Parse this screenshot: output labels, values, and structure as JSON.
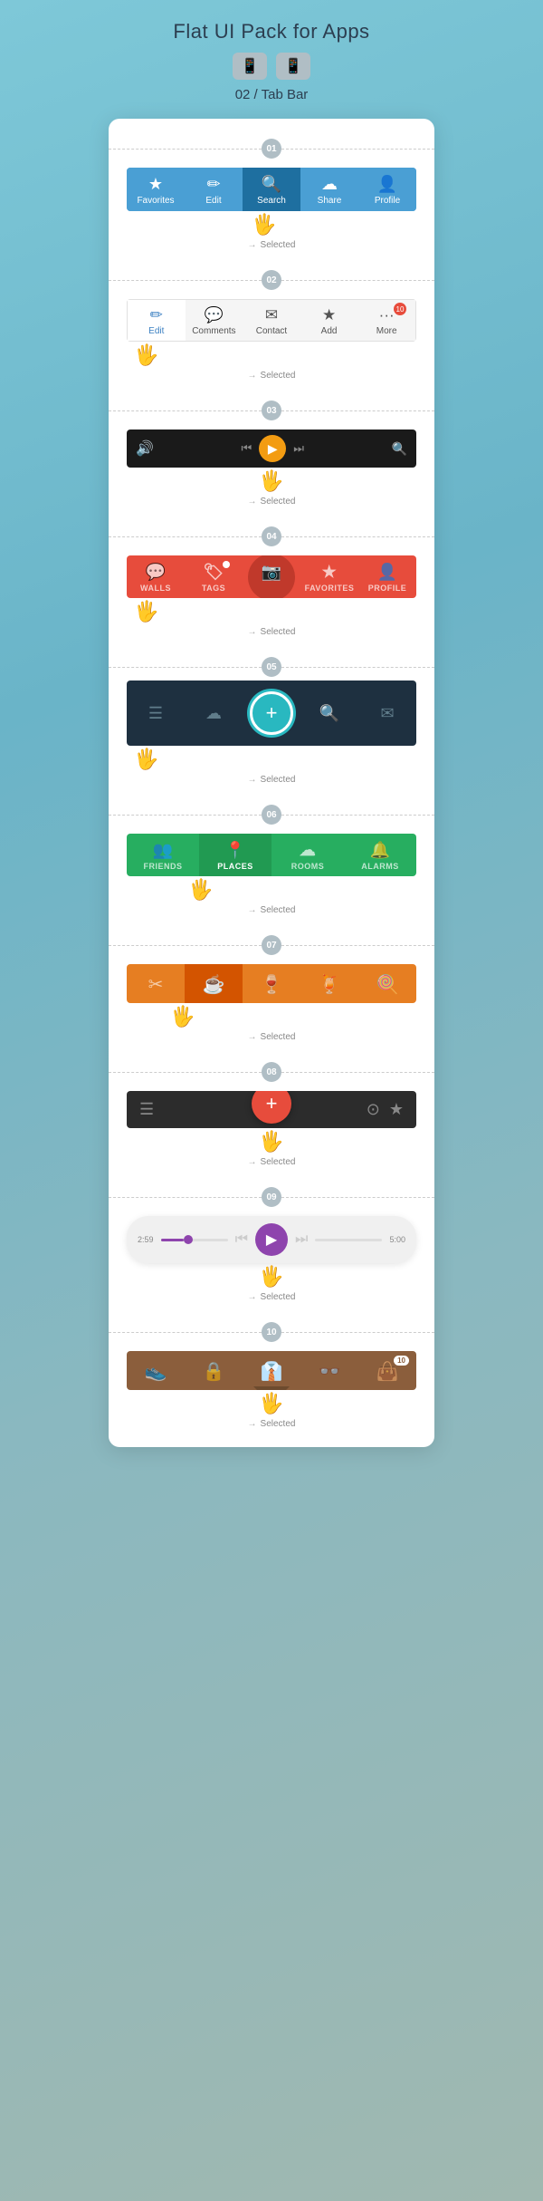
{
  "header": {
    "title": "Flat UI Pack for Apps",
    "subtitle": "02 / Tab Bar"
  },
  "sections": [
    {
      "id": "01",
      "tabs": [
        {
          "icon": "★",
          "label": "Favorites",
          "active": false
        },
        {
          "icon": "✎",
          "label": "Edit",
          "active": false
        },
        {
          "icon": "🔍",
          "label": "Search",
          "active": true
        },
        {
          "icon": "☁",
          "label": "Share",
          "active": false
        },
        {
          "icon": "👤",
          "label": "Profile",
          "active": false
        }
      ],
      "selected": "Selected",
      "selected_tab": "Search",
      "pointer_pos": "left_offset_2"
    },
    {
      "id": "02",
      "tabs": [
        {
          "icon": "✎",
          "label": "Edit",
          "active": true
        },
        {
          "icon": "···",
          "label": "Comments",
          "active": false
        },
        {
          "icon": "✉",
          "label": "Contact",
          "active": false
        },
        {
          "icon": "★",
          "label": "Add",
          "active": false
        },
        {
          "icon": "···",
          "label": "More",
          "active": false,
          "badge": "10"
        }
      ],
      "selected": "Selected",
      "pointer_pos": "left"
    },
    {
      "id": "03",
      "type": "media",
      "selected": "Selected"
    },
    {
      "id": "04",
      "tabs": [
        {
          "icon": "💬",
          "label": "WALLS",
          "active": false
        },
        {
          "icon": "🏷",
          "label": "TAGS",
          "active": false,
          "notif": true
        },
        {
          "icon": "📷",
          "label": "",
          "active": true
        },
        {
          "icon": "★",
          "label": "FAVORITES",
          "active": false
        },
        {
          "icon": "👤",
          "label": "PROFILE",
          "active": false
        }
      ],
      "selected": "Selected"
    },
    {
      "id": "05",
      "tabs": [
        {
          "icon": "☰",
          "active": false
        },
        {
          "icon": "☁",
          "active": false
        },
        {
          "icon": "+",
          "active": true
        },
        {
          "icon": "🔍",
          "active": false
        },
        {
          "icon": "✉",
          "active": false
        }
      ],
      "selected": "Selected"
    },
    {
      "id": "06",
      "tabs": [
        {
          "icon": "👥",
          "label": "FRIENDS",
          "active": false
        },
        {
          "icon": "📍",
          "label": "PLACES",
          "active": true
        },
        {
          "icon": "☁",
          "label": "ROOMS",
          "active": false
        },
        {
          "icon": "🔔",
          "label": "ALARMS",
          "active": false
        }
      ],
      "selected": "Selected"
    },
    {
      "id": "07",
      "tabs": [
        {
          "icon": "✂",
          "active": false
        },
        {
          "icon": "☕",
          "active": true
        },
        {
          "icon": "🍷",
          "active": false
        },
        {
          "icon": "🍹",
          "active": false
        },
        {
          "icon": "🍭",
          "active": false
        }
      ],
      "selected": "Selected"
    },
    {
      "id": "08",
      "left_icon": "☰",
      "add_label": "+",
      "right_icons": [
        "⊙",
        "★"
      ],
      "selected": "Selected"
    },
    {
      "id": "09",
      "time_left": "2:59",
      "time_right": "5:00",
      "selected": "Selected"
    },
    {
      "id": "10",
      "tabs": [
        {
          "icon": "👟",
          "active": false
        },
        {
          "icon": "🔒",
          "active": false
        },
        {
          "icon": "👔",
          "active": true
        },
        {
          "icon": "👓",
          "active": false
        },
        {
          "icon": "👜",
          "active": false,
          "badge": "10"
        }
      ],
      "selected": "Selected"
    }
  ]
}
